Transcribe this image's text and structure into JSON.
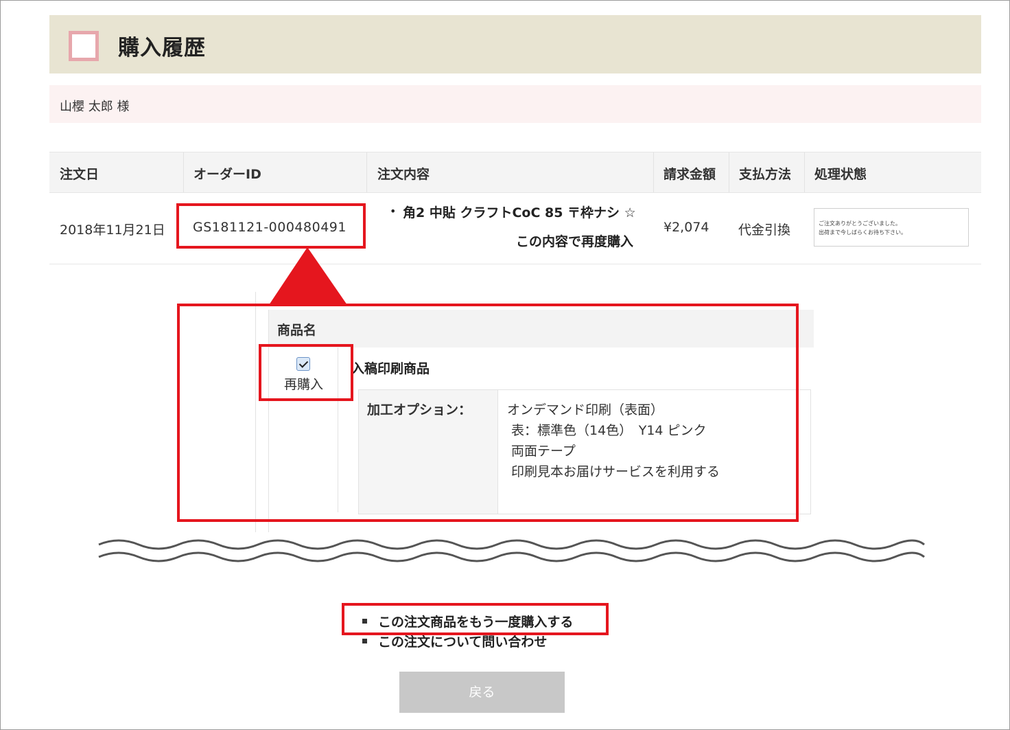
{
  "header": {
    "title": "購入履歴"
  },
  "customer": {
    "name": "山櫻 太郎 様"
  },
  "order_table": {
    "headers": {
      "date": "注文日",
      "order_id": "オーダーID",
      "contents": "注文内容",
      "amount": "請求金額",
      "payment": "支払方法",
      "status": "処理状態"
    },
    "row": {
      "date": "2018年11月21日",
      "order_id": "GS181121-000480491",
      "item": "角2 中貼 クラフトCoC 85 〒枠ナシ ☆",
      "rebuy_link": "この内容で再度購入",
      "amount": "¥2,074",
      "payment": "代金引換",
      "status": "ご注文ありがとうございました。\n出荷まで今しばらくお待ち下さい。"
    }
  },
  "product_detail": {
    "header": "商品名",
    "rebuy_label": "再購入",
    "rebuy_checked": true,
    "product_name": "入稿印刷商品",
    "options_label": "加工オプション：",
    "options": [
      "オンデマンド印刷（表面）",
      " 表：標準色（14色）　Y14 ピンク",
      " 両面テープ",
      " 印刷見本お届けサービスを利用する"
    ]
  },
  "links": {
    "buy_again": "この注文商品をもう一度購入する",
    "inquiry": "この注文について問い合わせ"
  },
  "buttons": {
    "back": "戻る"
  },
  "colors": {
    "header_bg": "#e8e4d2",
    "customer_bg": "#fcf2f2",
    "highlight": "#e5161e",
    "back_button": "#c8c8c8"
  }
}
